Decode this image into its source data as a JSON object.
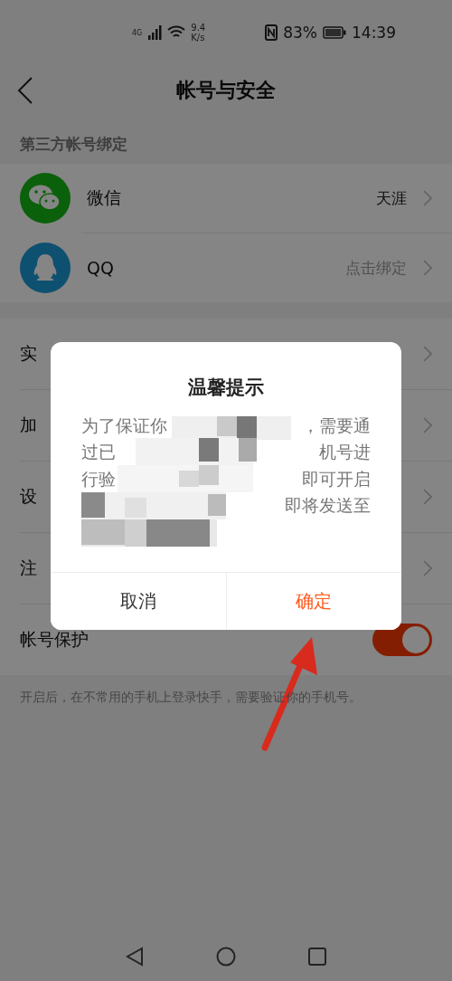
{
  "status_bar": {
    "network": "4G",
    "speed_value": "9.4",
    "speed_unit": "K/s",
    "battery": "83%",
    "time": "14:39"
  },
  "header": {
    "title": "帐号与安全"
  },
  "third_party": {
    "section_label": "第三方帐号绑定",
    "items": [
      {
        "kind": "wechat",
        "label": "微信",
        "value": "天涯",
        "bound": true
      },
      {
        "kind": "qq",
        "label": "QQ",
        "value": "点击绑定",
        "bound": false
      }
    ]
  },
  "settings": [
    {
      "kind": "link",
      "label": "实"
    },
    {
      "kind": "link",
      "label": "加"
    },
    {
      "kind": "link",
      "label": "设"
    },
    {
      "kind": "link",
      "label": "注"
    },
    {
      "kind": "toggle",
      "label": "帐号保护",
      "on": true
    }
  ],
  "footer_note": "开启后，在不常用的手机上登录快手，需要验证你的手机号。",
  "dialog": {
    "title": "温馨提示",
    "lines": [
      {
        "before": "为了保证你",
        "after": "，需要通"
      },
      {
        "before": "过已",
        "after": "机号进"
      },
      {
        "before": "行验",
        "after": "即可开启"
      },
      {
        "after": "即将发送至"
      }
    ],
    "buttons": [
      {
        "label": "取消",
        "primary": false
      },
      {
        "label": "确定",
        "primary": true
      }
    ]
  }
}
